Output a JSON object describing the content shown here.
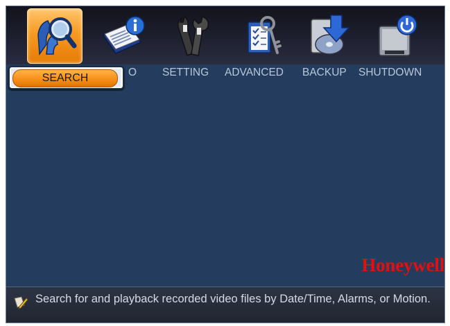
{
  "toolbar": {
    "items": [
      {
        "icon": "search-magnifier-icon",
        "active": true
      },
      {
        "icon": "info-book-icon",
        "active": false
      },
      {
        "icon": "wrench-tools-icon",
        "active": false
      },
      {
        "icon": "checklist-keys-icon",
        "active": false
      },
      {
        "icon": "backup-disc-icon",
        "active": false
      },
      {
        "icon": "shutdown-hdd-icon",
        "active": false
      }
    ]
  },
  "menu": {
    "search_label": "SEARCH",
    "info_label_fragment": "O",
    "setting_label": "SETTING",
    "advanced_label": "ADVANCED",
    "backup_label": "BACKUP",
    "shutdown_label": "SHUTDOWN"
  },
  "brand": {
    "name": "Honeywell",
    "color": "#e0110e"
  },
  "status_bar": {
    "icon": "note-pencil-icon",
    "text": "Search for and playback recorded video files by Date/Time, Alarms, or Motion."
  },
  "colors": {
    "panel_bg": "#243d5e",
    "accent_orange": "#f79018",
    "label_text": "#b9c7d9"
  }
}
